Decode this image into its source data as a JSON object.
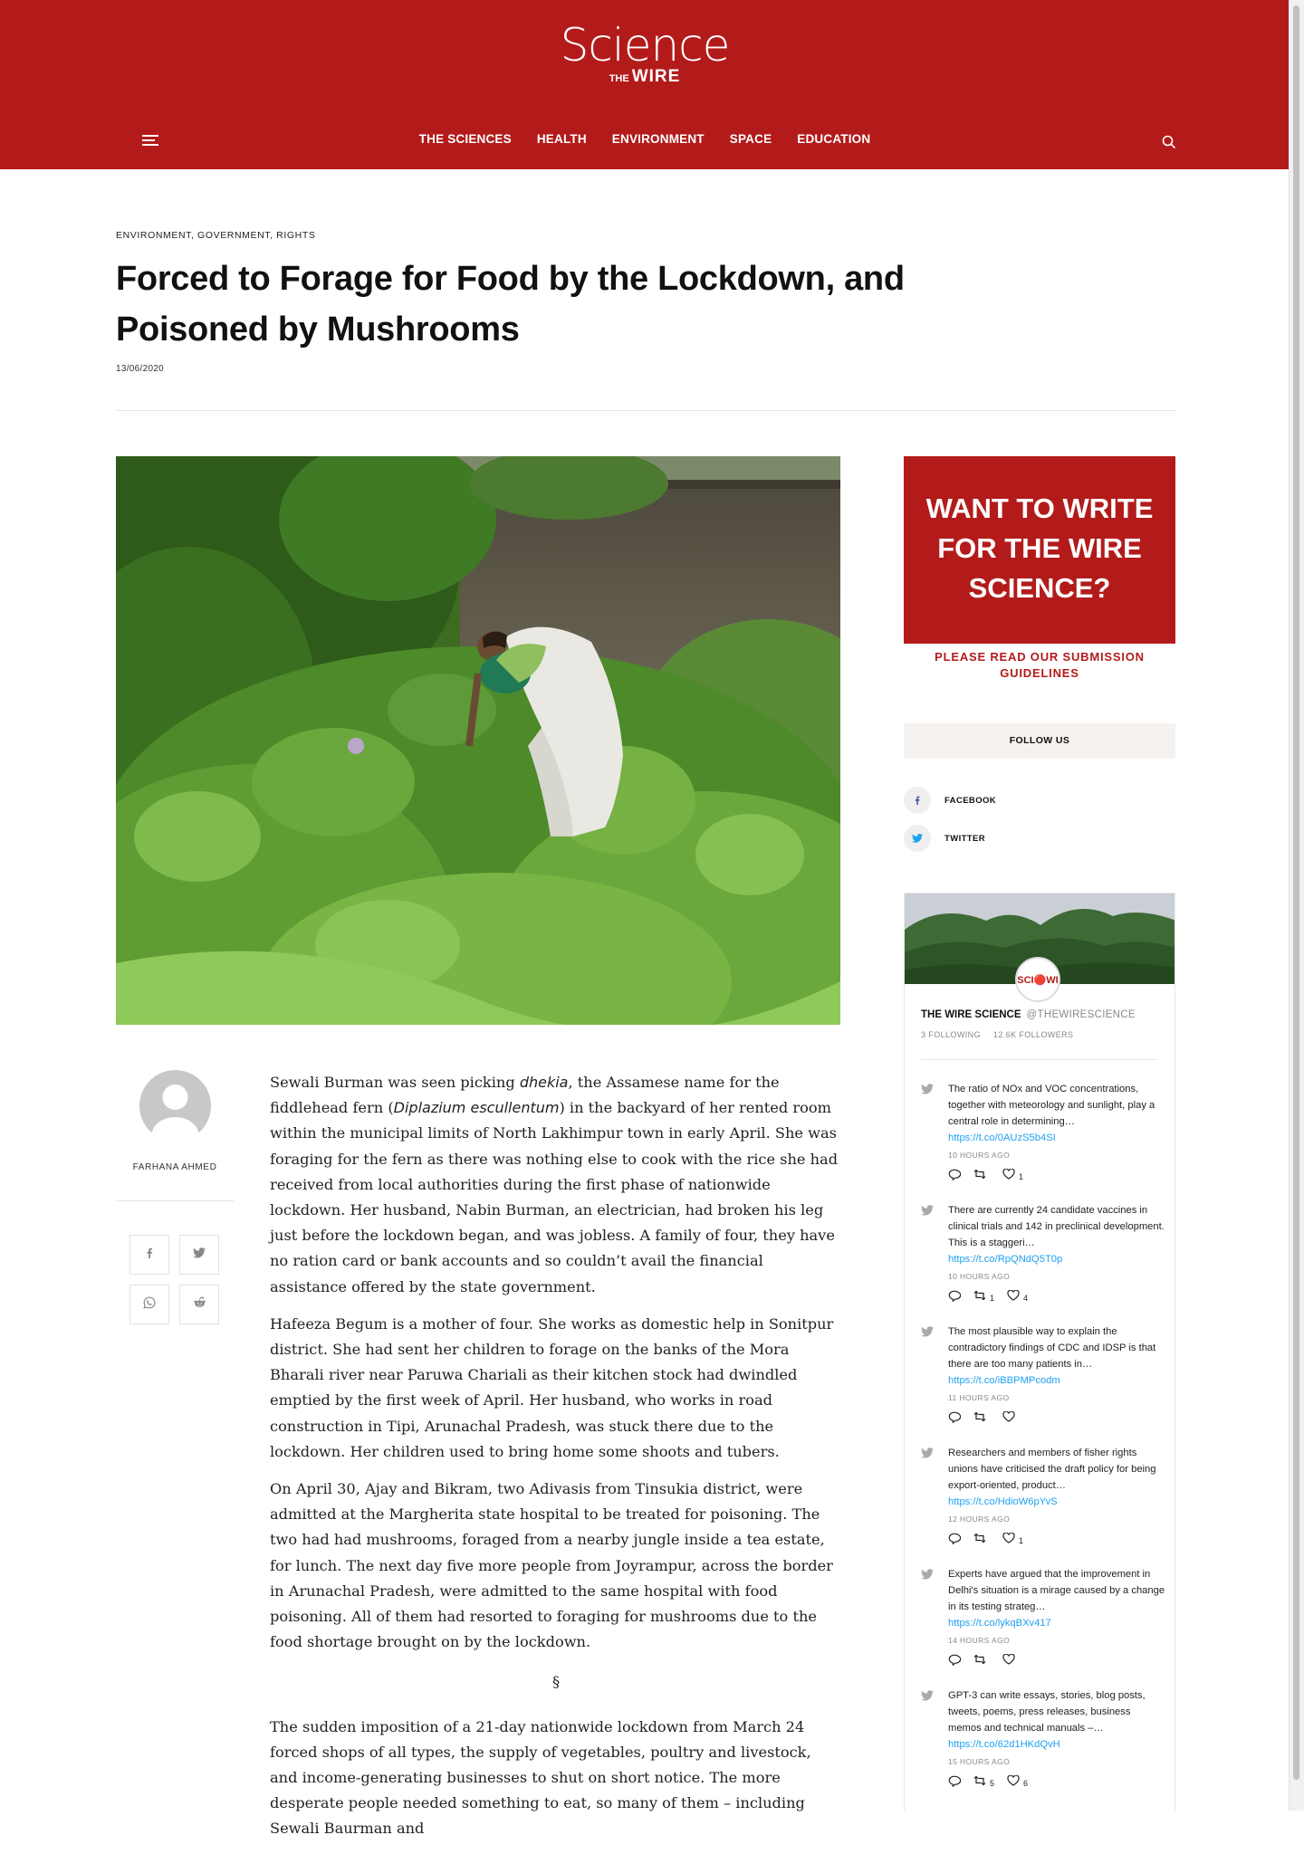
{
  "site": {
    "logo_main": "Science",
    "logo_the": "THE",
    "logo_wire": "WIRE",
    "nav": [
      "THE SCIENCES",
      "HEALTH",
      "ENVIRONMENT",
      "SPACE",
      "EDUCATION"
    ],
    "accent_color": "#b31b1b"
  },
  "article": {
    "categories": "ENVIRONMENT, GOVERNMENT, RIGHTS",
    "title": "Forced to Forage for Food by the Lockdown, and Poisoned by Mushrooms",
    "date": "13/06/2020",
    "hero_image": "woman-foraging-in-dense-green-vegetation",
    "author": "FARHANA AHMED",
    "share_icons": [
      "facebook-icon",
      "twitter-icon",
      "whatsapp-icon",
      "reddit-icon"
    ],
    "p1": {
      "a": "Sewali Burman was seen picking ",
      "b": "dhekia",
      "c": ", the Assamese name for the fiddlehead fern (",
      "d": "Diplazium escullentum",
      "e": ") in the backyard of her rented room within the municipal limits of North Lakhimpur town in early April. She was foraging for the fern as there was nothing else to cook with the rice she had received from local authorities during the first phase of nationwide lockdown. Her husband, Nabin Burman, an electrician, had broken his leg just before the lockdown began, and was jobless. A family of four, they have no ration card or bank accounts and so couldn’t avail the financial assistance offered by the state government."
    },
    "p2": "Hafeeza Begum is a mother of four. She works as domestic help in Sonitpur district. She had sent her children to forage on the banks of the Mora Bharali river near Paruwa Chariali as their kitchen stock had dwindled emptied by the first week of April. Her husband, who works in road construction in Tipi, Arunachal Pradesh, was stuck there due to the lockdown. Her children used to bring home some shoots and tubers.",
    "p3": "On April 30, Ajay and Bikram, two Adivasis from Tinsukia district, were admitted at the Margherita state hospital to be treated for poisoning. The two had had mushrooms, foraged from a nearby jungle inside a tea estate, for lunch. The next day five more people from Joyrampur, across the border in Arunachal Pradesh, were admitted to the same hospital with food poisoning. All of them had resorted to foraging for mushrooms due to the food shortage brought on by the lockdown.",
    "section_mark": "§",
    "p4": "The sudden imposition of a 21-day nationwide lockdown from March 24 forced shops of all types, the supply of vegetables, poultry and livestock, and income-generating businesses to shut on short notice. The more desperate people needed something to eat, so many of them – including Sewali Baurman and"
  },
  "sidebar": {
    "promo_text": "WANT TO WRITE FOR THE WIRE SCIENCE?",
    "promo_link": "PLEASE READ OUR SUBMISSION GUIDELINES",
    "follow_heading": "FOLLOW US",
    "social": [
      {
        "label": "FACEBOOK",
        "icon": "facebook-icon"
      },
      {
        "label": "TWITTER",
        "icon": "twitter-icon"
      }
    ],
    "twitter": {
      "avatar_text": "SCI🔴WI",
      "name": "THE WIRE SCIENCE",
      "handle": "@THEWIRESCIENCE",
      "following": "3 FOLLOWING",
      "followers": "12.6K FOLLOWERS",
      "tweets": [
        {
          "text": "The ratio of NOx and VOC concentrations, together with meteorology and sunlight, play a central role in determining…",
          "link": "https://t.co/0AUzS5b4SI",
          "time": "10 HOURS AGO",
          "retweets": "",
          "likes": "1"
        },
        {
          "text": "There are currently 24 candidate vaccines in clinical trials and 142 in preclinical development. This is a staggeri…",
          "link": "https://t.co/RpQNdQ5T0p",
          "time": "10 HOURS AGO",
          "retweets": "1",
          "likes": "4"
        },
        {
          "text": "The most plausible way to explain the contradictory findings of CDC and IDSP is that there are too many patients in…",
          "link": "https://t.co/iBBPMPcodm",
          "time": "11 HOURS AGO",
          "retweets": "",
          "likes": ""
        },
        {
          "text": "Researchers and members of fisher rights unions have criticised the draft policy for being export-oriented, product…",
          "link": "https://t.co/HdioW6pYvS",
          "time": "12 HOURS AGO",
          "retweets": "",
          "likes": "1"
        },
        {
          "text": "Experts have argued that the improvement in Delhi's situation is a mirage caused by a change in its testing strateg…",
          "link": "https://t.co/lykqBXv417",
          "time": "14 HOURS AGO",
          "retweets": "",
          "likes": ""
        },
        {
          "text": "GPT-3 can write essays, stories, blog posts, tweets, poems, press releases, business memos and technical manuals –…",
          "link": "https://t.co/62d1HKdQvH",
          "time": "15 HOURS AGO",
          "retweets": "5",
          "likes": "6"
        }
      ]
    }
  }
}
